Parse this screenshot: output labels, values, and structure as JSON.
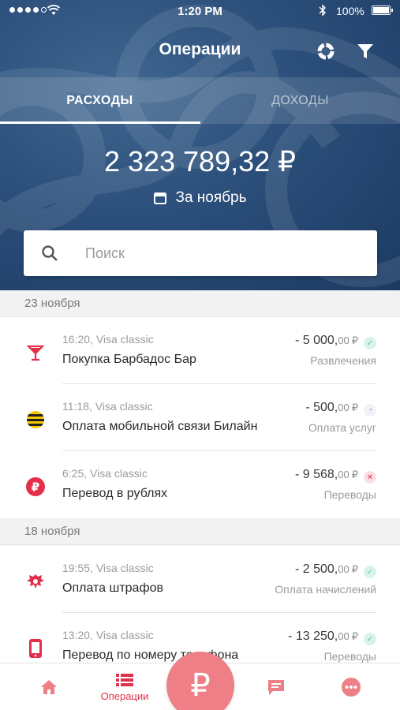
{
  "status_bar": {
    "time": "1:20 PM",
    "battery": "100%"
  },
  "header": {
    "title": "Операции"
  },
  "tabs": [
    {
      "label": "РАСХОДЫ",
      "active": true
    },
    {
      "label": "ДОХОДЫ",
      "active": false
    }
  ],
  "summary": {
    "amount": "2 323 789,32 ₽",
    "period": "За ноябрь"
  },
  "search": {
    "placeholder": "Поиск"
  },
  "sections": [
    {
      "date": "23 ноября",
      "items": [
        {
          "meta": "16:20, Visa classic",
          "title": "Покупка Барбадос Бар",
          "amount_main": "- 5 000,",
          "amount_cents": "00",
          "currency": "₽",
          "category": "Развлечения",
          "status": "check",
          "icon": "cocktail-icon"
        },
        {
          "meta": "11:18, Visa classic",
          "title": "Оплата мобильной связи Билайн",
          "amount_main": "- 500,",
          "amount_cents": "00",
          "currency": "₽",
          "category": "Оплата услуг",
          "status": "pending",
          "icon": "beeline-icon"
        },
        {
          "meta": "6:25, Visa classic",
          "title": "Перевод в рублях",
          "amount_main": "- 9 568,",
          "amount_cents": "00",
          "currency": "₽",
          "category": "Переводы",
          "status": "declined",
          "icon": "ruble-icon"
        }
      ]
    },
    {
      "date": "18 ноября",
      "items": [
        {
          "meta": "19:55, Visa classic",
          "title": "Оплата штрафов",
          "amount_main": "- 2 500,",
          "amount_cents": "00",
          "currency": "₽",
          "category": "Оплата начислений",
          "status": "check",
          "icon": "coat-of-arms-icon"
        },
        {
          "meta": "13:20, Visa classic",
          "title": "Перевод по номеру телефона",
          "amount_main": "- 13 250,",
          "amount_cents": "00",
          "currency": "₽",
          "category": "Переводы",
          "status": "check",
          "icon": "phone-icon"
        }
      ]
    }
  ],
  "tabbar": {
    "operations_label": "Операции",
    "fab_symbol": "₽"
  },
  "colors": {
    "accent": "#e2304a",
    "header_bg": "#2b4f7a",
    "check": "#6fcfb5",
    "declined": "#e2304a"
  }
}
